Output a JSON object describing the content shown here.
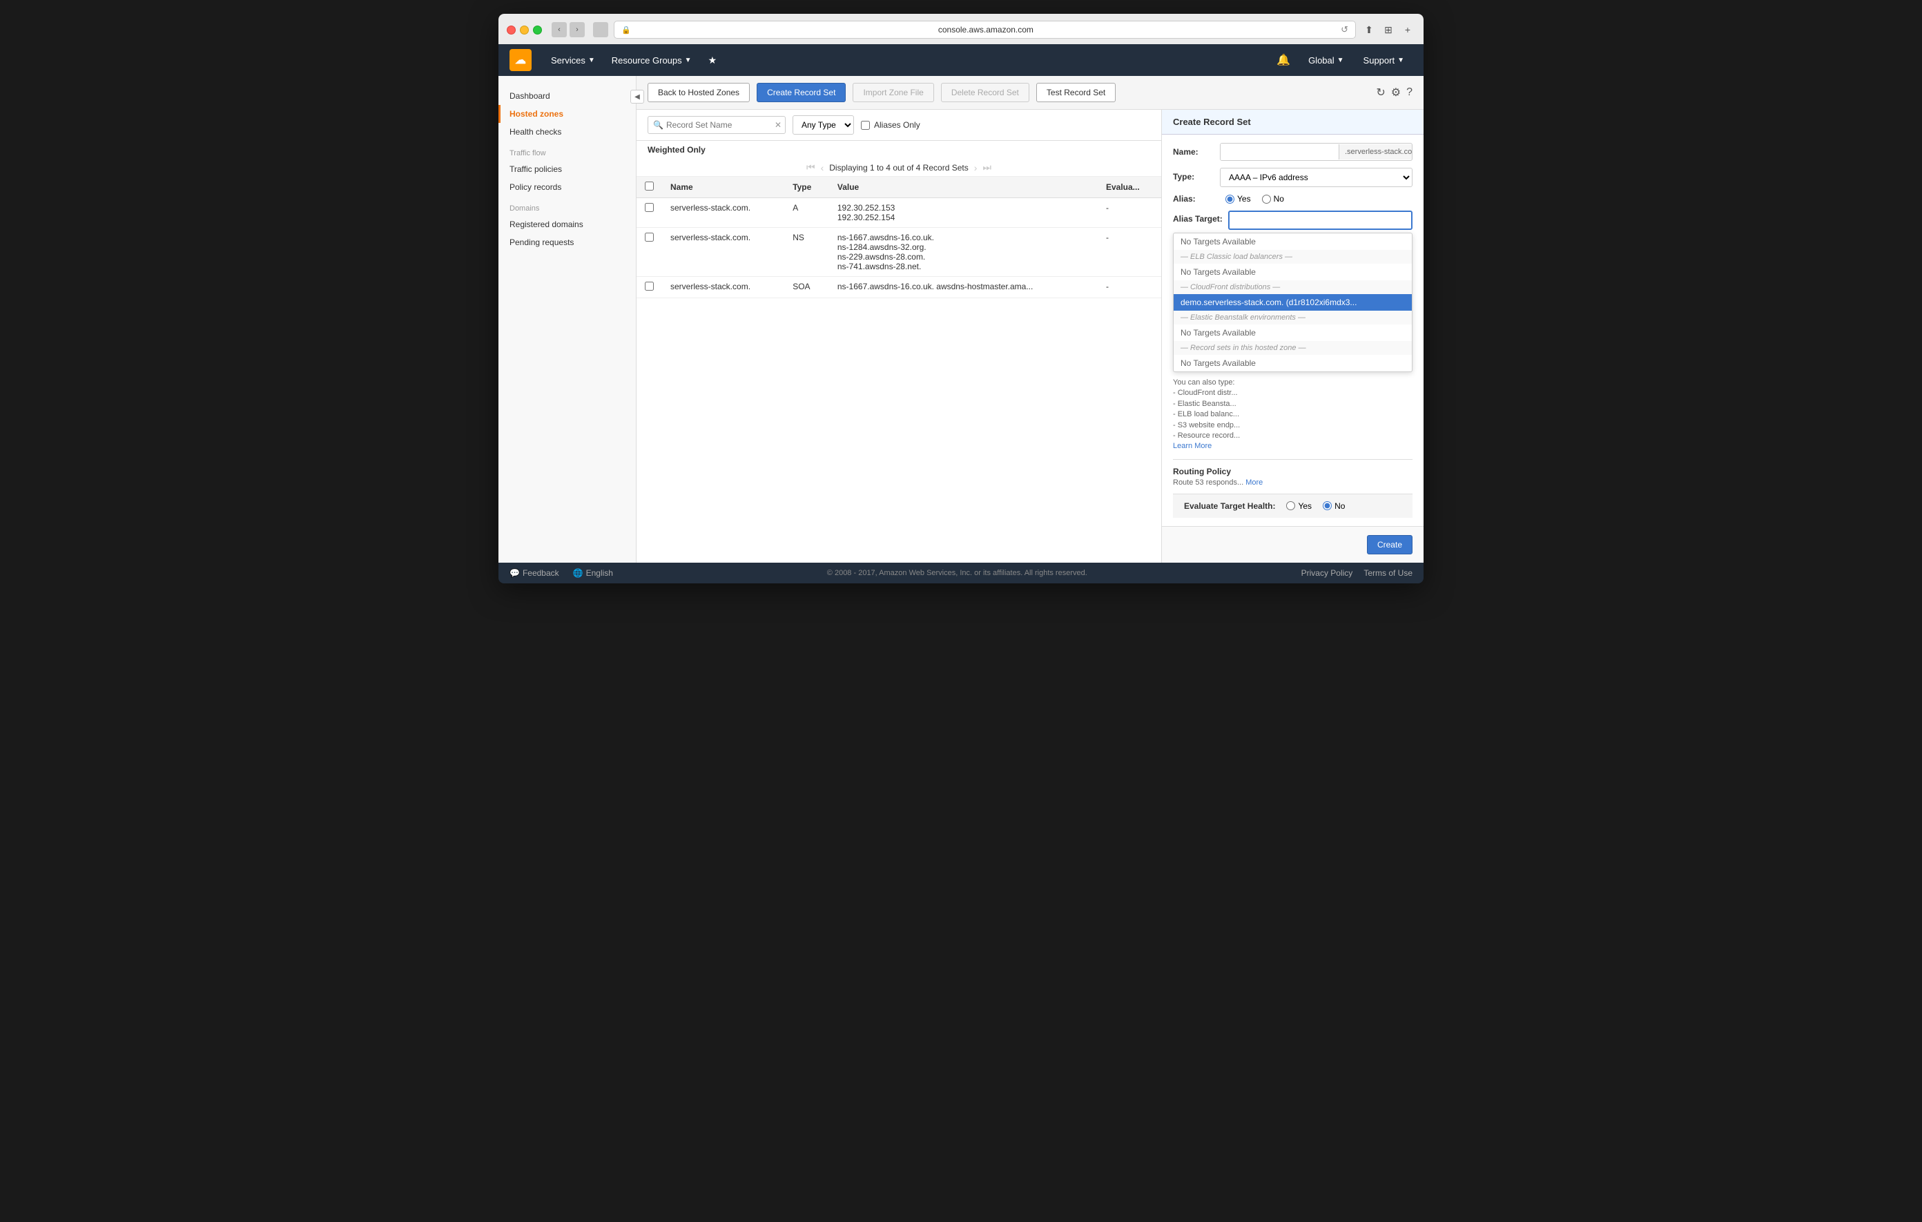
{
  "browser": {
    "url": "console.aws.amazon.com"
  },
  "topnav": {
    "logo": "🟠",
    "services_label": "Services",
    "resource_groups_label": "Resource Groups",
    "global_label": "Global",
    "support_label": "Support"
  },
  "sidebar": {
    "dashboard_label": "Dashboard",
    "hosted_zones_label": "Hosted zones",
    "health_checks_label": "Health checks",
    "traffic_flow_section": "Traffic flow",
    "traffic_policies_label": "Traffic policies",
    "policy_records_label": "Policy records",
    "domains_section": "Domains",
    "registered_domains_label": "Registered domains",
    "pending_requests_label": "Pending requests"
  },
  "toolbar": {
    "back_label": "Back to Hosted Zones",
    "create_label": "Create Record Set",
    "import_label": "Import Zone File",
    "delete_label": "Delete Record Set",
    "test_label": "Test Record Set"
  },
  "filter": {
    "search_placeholder": "Record Set Name",
    "type_label": "Any Type",
    "aliases_label": "Aliases Only"
  },
  "table": {
    "section_label": "Weighted Only",
    "pagination_text": "Displaying 1 to 4 out of 4 Record Sets",
    "columns": [
      "Name",
      "Type",
      "Value",
      "Evalua..."
    ],
    "rows": [
      {
        "name": "serverless-stack.com.",
        "type": "A",
        "value": "192.30.252.153\n192.30.252.154",
        "evaluate": "-"
      },
      {
        "name": "serverless-stack.com.",
        "type": "NS",
        "value": "ns-1667.awsdns-16.co.uk.\nns-1284.awsdns-32.org.\nns-229.awsdns-28.com.\nns-741.awsdns-28.net.",
        "evaluate": "-"
      },
      {
        "name": "serverless-stack.com.",
        "type": "SOA",
        "value": "ns-1667.awsdns-16.co.uk. awsdns-hostmaster.ama...",
        "evaluate": "-"
      }
    ]
  },
  "panel": {
    "title": "Create Record Set",
    "name_label": "Name:",
    "name_suffix": ".serverless-stack.com.",
    "type_label": "Type:",
    "type_value": "AAAA – IPv6 address",
    "alias_label": "Alias:",
    "alias_yes": "Yes",
    "alias_no": "No",
    "alias_target_label": "Alias Target:",
    "alias_target_placeholder": "",
    "helper_text": "You can also type:",
    "helper_cloudfront": "- CloudFront distr...",
    "helper_elb_classic": "- Elastic Beansta...",
    "helper_elb": "- ELB load balanc...",
    "helper_s3": "- S3 website endp...",
    "helper_resource": "- Resource record...",
    "learn_more": "Learn More",
    "routing_policy_label": "Routing Policy",
    "routing_desc": "Route 53 responds...",
    "more_link": "More",
    "evaluate_label": "Evaluate Target Health:",
    "evaluate_yes": "Yes",
    "evaluate_no": "No",
    "create_btn": "Create",
    "dropdown": {
      "elb_classic_header": "— ELB Classic load balancers —",
      "no_targets_elb_classic": "No Targets Available",
      "cloudfront_header": "— CloudFront distributions —",
      "cloudfront_item": "demo.serverless-stack.com. (d1r8102xi6mdx3...",
      "elastic_header": "— Elastic Beanstalk environments —",
      "no_targets_elastic": "No Targets Available",
      "record_sets_header": "— Record sets in this hosted zone —",
      "no_targets_record": "No Targets Available",
      "no_targets_top": "No Targets Available"
    }
  },
  "footer": {
    "feedback_label": "Feedback",
    "language_label": "English",
    "copyright": "© 2008 - 2017, Amazon Web Services, Inc. or its affiliates. All rights reserved.",
    "privacy_label": "Privacy Policy",
    "terms_label": "Terms of Use"
  }
}
